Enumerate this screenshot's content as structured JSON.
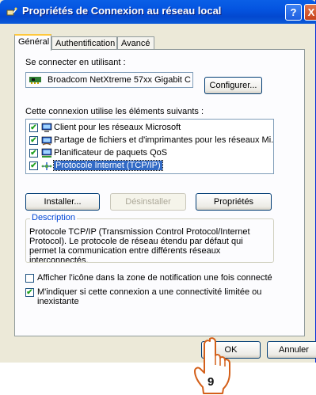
{
  "window": {
    "title": "Propriétés de Connexion au réseau local",
    "help_label": "?",
    "close_label": "X"
  },
  "tabs": [
    {
      "label": "Général"
    },
    {
      "label": "Authentification"
    },
    {
      "label": "Avancé"
    }
  ],
  "connect_using": {
    "label": "Se connecter en utilisant :",
    "device": "Broadcom NetXtreme 57xx Gigabit C",
    "configure_label": "Configurer..."
  },
  "components": {
    "label": "Cette connexion utilise les éléments suivants :",
    "items": [
      {
        "label": "Client pour les réseaux Microsoft",
        "checked": true,
        "icon": "network-client-icon"
      },
      {
        "label": "Partage de fichiers et d'imprimantes pour les réseaux Mi...",
        "checked": true,
        "icon": "file-printer-sharing-icon"
      },
      {
        "label": "Planificateur de paquets QoS",
        "checked": true,
        "icon": "qos-scheduler-icon"
      },
      {
        "label": "Protocole Internet (TCP/IP)",
        "checked": true,
        "selected": true,
        "icon": "network-protocol-icon"
      }
    ]
  },
  "buttons": {
    "install": "Installer...",
    "uninstall": "Désinstaller",
    "properties": "Propriétés",
    "ok": "OK",
    "cancel": "Annuler"
  },
  "description": {
    "legend": "Description",
    "text": "Protocole TCP/IP (Transmission Control Protocol/Internet Protocol). Le protocole de réseau étendu par défaut qui permet la communication entre différents réseaux interconnectés."
  },
  "options": {
    "show_icon": {
      "label": "Afficher l'icône dans la zone de notification une fois connecté",
      "checked": false
    },
    "notify_limited": {
      "label": "M'indiquer si cette connexion a une connectivité limitée ou inexistante",
      "checked": true
    }
  },
  "annotation": {
    "step": "9"
  },
  "colors": {
    "titlebar": "#0454e0",
    "dialog_bg": "#ece9d8",
    "selection": "#316ac5",
    "group_legend": "#0046d5",
    "checkmark": "#21a121",
    "callout_border": "#d4601a"
  }
}
